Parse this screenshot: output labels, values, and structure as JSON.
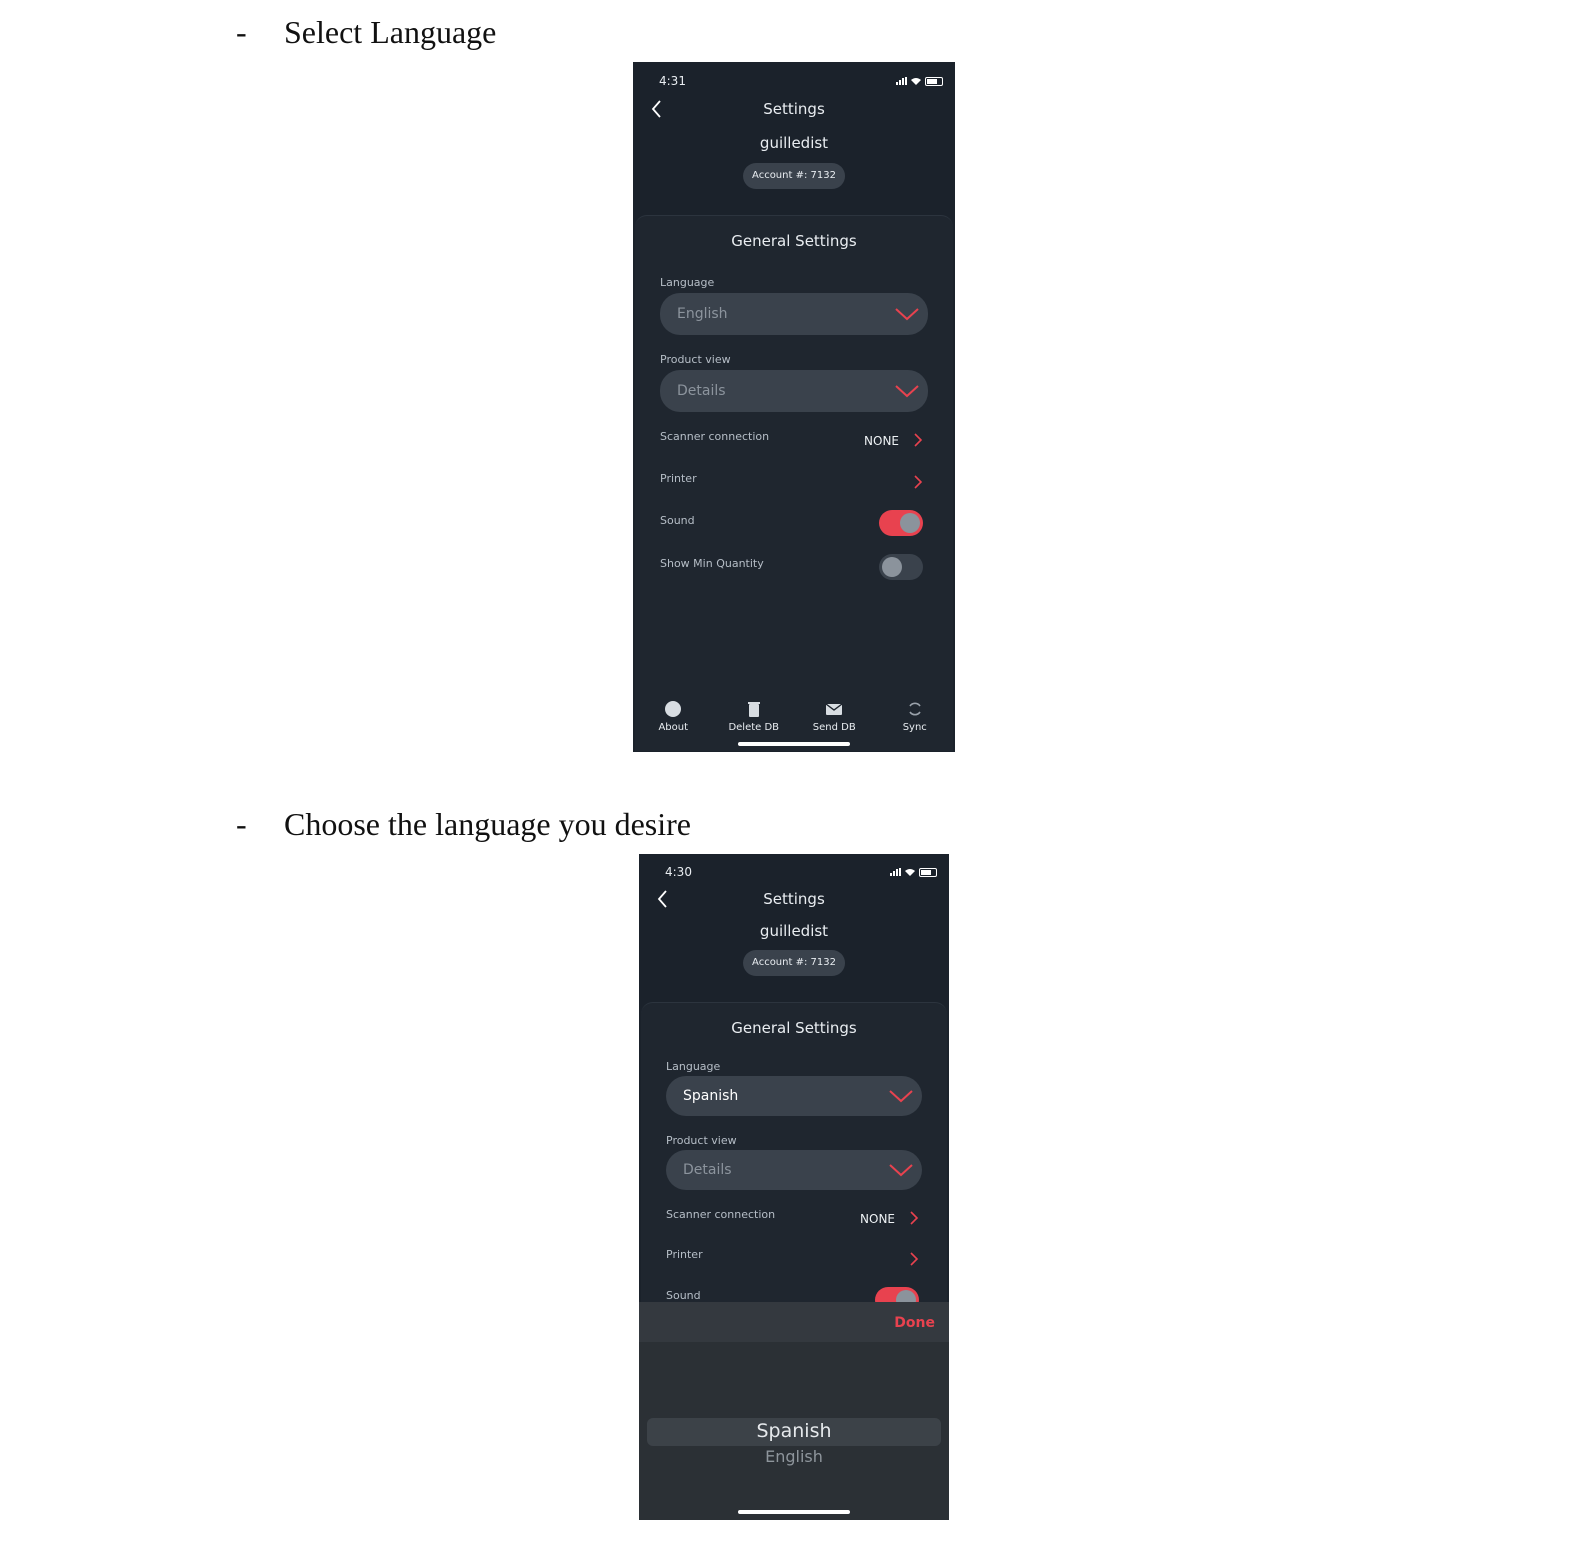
{
  "steps": [
    {
      "bullet": "-",
      "text": "Select Language"
    },
    {
      "bullet": "-",
      "text": "Choose the language you desire"
    }
  ],
  "screens": [
    {
      "time": "4:31",
      "nav_title": "Settings",
      "username": "guilledist",
      "account": "Account #: 7132",
      "section_title": "General Settings",
      "language_label": "Language",
      "language_value": "English",
      "product_view_label": "Product view",
      "product_view_value": "Details",
      "scanner_label": "Scanner connection",
      "scanner_value": "NONE",
      "printer_label": "Printer",
      "sound_label": "Sound",
      "sound_on": true,
      "min_qty_label": "Show Min Quantity",
      "min_qty_on": false,
      "tabs": [
        "About",
        "Delete DB",
        "Send DB",
        "Sync"
      ]
    },
    {
      "time": "4:30",
      "nav_title": "Settings",
      "username": "guilledist",
      "account": "Account #: 7132",
      "section_title": "General Settings",
      "language_label": "Language",
      "language_value": "Spanish",
      "product_view_label": "Product view",
      "product_view_value": "Details",
      "scanner_label": "Scanner connection",
      "scanner_value": "NONE",
      "printer_label": "Printer",
      "sound_label": "Sound",
      "done_label": "Done",
      "picker_options": [
        "Spanish",
        "English"
      ],
      "picker_selected": "Spanish"
    }
  ],
  "colors": {
    "accent": "#e8424f",
    "phone_bg": "#1b222b",
    "field_bg": "#3a424c"
  },
  "icons": [
    "back-chevron-icon",
    "chevron-down-icon",
    "chevron-right-icon",
    "about-icon",
    "trash-icon",
    "mail-icon",
    "sync-icon"
  ]
}
